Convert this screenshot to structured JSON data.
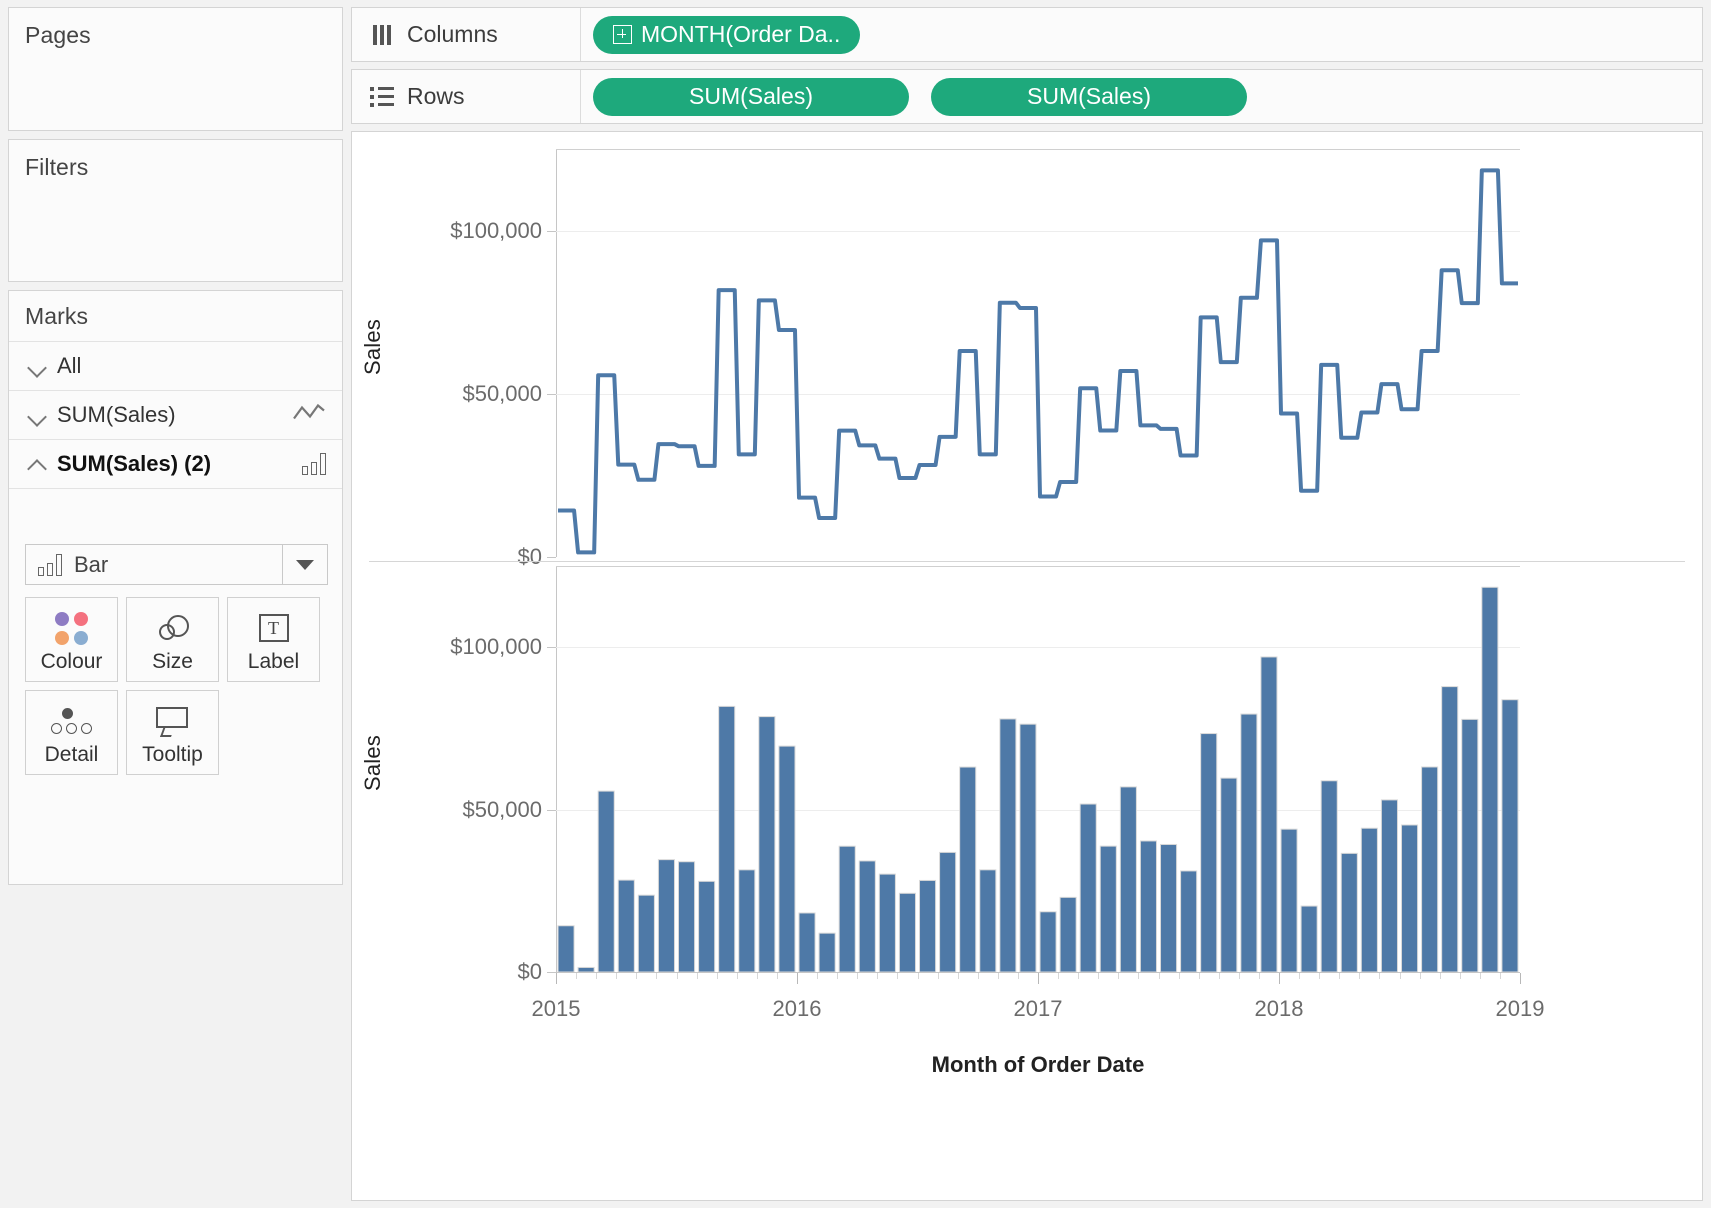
{
  "panels": {
    "pages": {
      "title": "Pages"
    },
    "filters": {
      "title": "Filters"
    },
    "marks": {
      "title": "Marks",
      "rows": [
        {
          "label": "All",
          "icon": "chevron-down-icon",
          "type_icon": ""
        },
        {
          "label": "SUM(Sales)",
          "icon": "chevron-down-icon",
          "type_icon": "line-icon"
        },
        {
          "label": "SUM(Sales) (2)",
          "icon": "chevron-up-icon",
          "type_icon": "bar-icon"
        }
      ],
      "mark_type": {
        "label": "Bar",
        "icon": "bar-icon"
      },
      "properties": [
        {
          "label": "Colour",
          "icon": "colour-dots-icon"
        },
        {
          "label": "Size",
          "icon": "size-circles-icon"
        },
        {
          "label": "Label",
          "icon": "label-text-icon",
          "glyph": "T"
        },
        {
          "label": "Detail",
          "icon": "detail-dots-icon"
        },
        {
          "label": "Tooltip",
          "icon": "tooltip-icon"
        }
      ]
    }
  },
  "shelves": {
    "columns": {
      "name": "Columns",
      "icon": "columns-icon",
      "pills": [
        {
          "label": "MONTH(Order Da..",
          "icon": "plus-box-icon"
        }
      ]
    },
    "rows": {
      "name": "Rows",
      "icon": "rows-icon",
      "pills": [
        {
          "label": "SUM(Sales)"
        },
        {
          "label": "SUM(Sales)"
        }
      ]
    }
  },
  "colors": {
    "pill_green": "#1ea97c",
    "mark_blue": "#4e79a7",
    "line_blue": "#4d79a8",
    "gridline": "#ededed",
    "axis": "#c6c6c6"
  },
  "chart_data": [
    {
      "type": "line",
      "title": "",
      "xlabel": "Month of Order Date",
      "ylabel": "Sales",
      "ylim": [
        0,
        125000
      ],
      "yticks": [
        0,
        50000,
        100000
      ],
      "ytick_labels": [
        "$0",
        "$50,000",
        "$100,000"
      ],
      "xtick_labels": [
        "2015",
        "2016",
        "2017",
        "2018",
        "2019"
      ],
      "xtick_values": [
        0,
        12,
        24,
        36,
        48
      ],
      "grid": true,
      "legend": "none",
      "step": true,
      "x": [
        "2015-01",
        "2015-02",
        "2015-03",
        "2015-04",
        "2015-05",
        "2015-06",
        "2015-07",
        "2015-08",
        "2015-09",
        "2015-10",
        "2015-11",
        "2015-12",
        "2016-01",
        "2016-02",
        "2016-03",
        "2016-04",
        "2016-05",
        "2016-06",
        "2016-07",
        "2016-08",
        "2016-09",
        "2016-10",
        "2016-11",
        "2016-12",
        "2017-01",
        "2017-02",
        "2017-03",
        "2017-04",
        "2017-05",
        "2017-06",
        "2017-07",
        "2017-08",
        "2017-09",
        "2017-10",
        "2017-11",
        "2017-12",
        "2018-01",
        "2018-02",
        "2018-03",
        "2018-04",
        "2018-05",
        "2018-06",
        "2018-07",
        "2018-08",
        "2018-09",
        "2018-10",
        "2018-11",
        "2018-12"
      ],
      "values": [
        14236,
        1402,
        55691,
        28295,
        23648,
        34595,
        33946,
        27909,
        81777,
        31453,
        78629,
        69545,
        18174,
        11951,
        38726,
        34196,
        30132,
        24221,
        28187,
        36819,
        63100,
        31453,
        77908,
        76300,
        18542,
        22979,
        51716,
        38750,
        56988,
        40344,
        39262,
        31115,
        73410,
        59688,
        79412,
        96999,
        43971,
        20301,
        58872,
        36522,
        44261,
        52982,
        45264,
        63121,
        87867,
        77777,
        118448,
        83829
      ]
    },
    {
      "type": "bar",
      "title": "",
      "xlabel": "Month of Order Date",
      "ylabel": "Sales",
      "ylim": [
        0,
        125000
      ],
      "yticks": [
        0,
        50000,
        100000
      ],
      "ytick_labels": [
        "$0",
        "$50,000",
        "$100,000"
      ],
      "xtick_labels": [
        "2015",
        "2016",
        "2017",
        "2018",
        "2019"
      ],
      "xtick_values": [
        0,
        12,
        24,
        36,
        48
      ],
      "grid": true,
      "legend": "none",
      "categories": [
        "2015-01",
        "2015-02",
        "2015-03",
        "2015-04",
        "2015-05",
        "2015-06",
        "2015-07",
        "2015-08",
        "2015-09",
        "2015-10",
        "2015-11",
        "2015-12",
        "2016-01",
        "2016-02",
        "2016-03",
        "2016-04",
        "2016-05",
        "2016-06",
        "2016-07",
        "2016-08",
        "2016-09",
        "2016-10",
        "2016-11",
        "2016-12",
        "2017-01",
        "2017-02",
        "2017-03",
        "2017-04",
        "2017-05",
        "2017-06",
        "2017-07",
        "2017-08",
        "2017-09",
        "2017-10",
        "2017-11",
        "2017-12",
        "2018-01",
        "2018-02",
        "2018-03",
        "2018-04",
        "2018-05",
        "2018-06",
        "2018-07",
        "2018-08",
        "2018-09",
        "2018-10",
        "2018-11",
        "2018-12"
      ],
      "values": [
        14236,
        1402,
        55691,
        28295,
        23648,
        34595,
        33946,
        27909,
        81777,
        31453,
        78629,
        69545,
        18174,
        11951,
        38726,
        34196,
        30132,
        24221,
        28187,
        36819,
        63100,
        31453,
        77908,
        76300,
        18542,
        22979,
        51716,
        38750,
        56988,
        40344,
        39262,
        31115,
        73410,
        59688,
        79412,
        96999,
        43971,
        20301,
        58872,
        36522,
        44261,
        52982,
        45264,
        63121,
        87867,
        77777,
        118448,
        83829
      ]
    }
  ]
}
